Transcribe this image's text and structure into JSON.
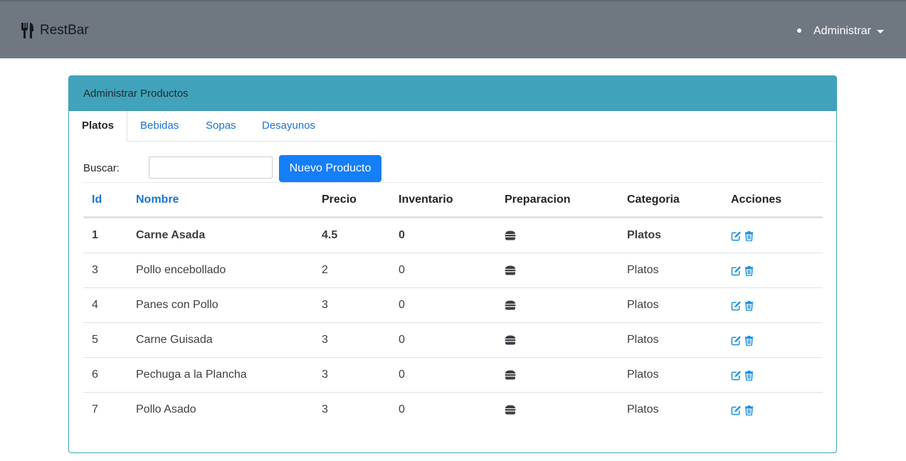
{
  "navbar": {
    "brand": "RestBar",
    "brand_icon": "utensils-icon",
    "menu_label": "Administrar"
  },
  "card": {
    "title": "Administrar Productos",
    "tabs": [
      {
        "label": "Platos",
        "active": true
      },
      {
        "label": "Bebidas",
        "active": false
      },
      {
        "label": "Sopas",
        "active": false
      },
      {
        "label": "Desayunos",
        "active": false
      }
    ],
    "search": {
      "label": "Buscar:",
      "value": "",
      "placeholder": ""
    },
    "new_button": "Nuevo Producto"
  },
  "table": {
    "headers": {
      "id": "Id",
      "nombre": "Nombre",
      "precio": "Precio",
      "inventario": "Inventario",
      "preparacion": "Preparacion",
      "categoria": "Categoria",
      "acciones": "Acciones"
    },
    "rows": [
      {
        "id": "1",
        "nombre": "Carne Asada",
        "precio": "4.5",
        "inventario": "0",
        "categoria": "Platos"
      },
      {
        "id": "3",
        "nombre": "Pollo encebollado",
        "precio": "2",
        "inventario": "0",
        "categoria": "Platos"
      },
      {
        "id": "4",
        "nombre": "Panes con Pollo",
        "precio": "3",
        "inventario": "0",
        "categoria": "Platos"
      },
      {
        "id": "5",
        "nombre": "Carne Guisada",
        "precio": "3",
        "inventario": "0",
        "categoria": "Platos"
      },
      {
        "id": "6",
        "nombre": "Pechuga a la Plancha",
        "precio": "3",
        "inventario": "0",
        "categoria": "Platos"
      },
      {
        "id": "7",
        "nombre": "Pollo Asado",
        "precio": "3",
        "inventario": "0",
        "categoria": "Platos"
      }
    ],
    "icons": {
      "preparacion": "burger-icon",
      "edit": "edit-icon",
      "delete": "trash-icon"
    }
  },
  "colors": {
    "navbar": "#6f7780",
    "card_header": "#41a3bb",
    "primary": "#157ef9",
    "link": "#1a73d9"
  }
}
